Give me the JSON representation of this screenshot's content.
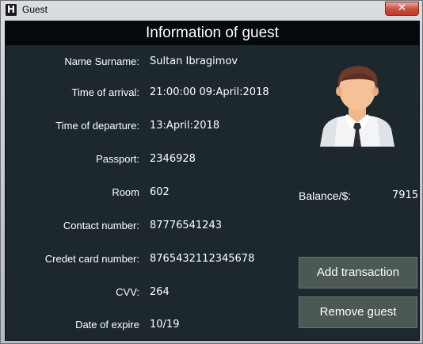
{
  "window": {
    "title": "Guest",
    "app_icon_letter": "H",
    "close_glyph": "✕"
  },
  "header": {
    "title": "Information of guest"
  },
  "fields": [
    {
      "label": "Name Surname:",
      "value": "Sultan Ibragimov"
    },
    {
      "label": "Time of arrival:",
      "value": "21:00:00 09:April:2018"
    },
    {
      "label": "Time of departure:",
      "value": "13:April:2018"
    },
    {
      "label": "Passport:",
      "value": "2346928"
    },
    {
      "label": "Room",
      "value": "602"
    },
    {
      "label": "Contact number:",
      "value": "87776541243"
    },
    {
      "label": "Credet card number:",
      "value": "8765432112345678"
    },
    {
      "label": "CVV:",
      "value": "264"
    },
    {
      "label": "Date of expire",
      "value": "10/19"
    }
  ],
  "balance": {
    "label": "Balance/$:",
    "value": "7915"
  },
  "buttons": {
    "add_transaction": "Add transaction",
    "remove_guest": "Remove guest"
  },
  "avatar": {
    "icon": "user-avatar-icon"
  },
  "colors": {
    "panel_bg": "#1c282d",
    "header_bg": "#050909",
    "button_bg": "#4b5854",
    "close_button": "#c94c3b"
  }
}
